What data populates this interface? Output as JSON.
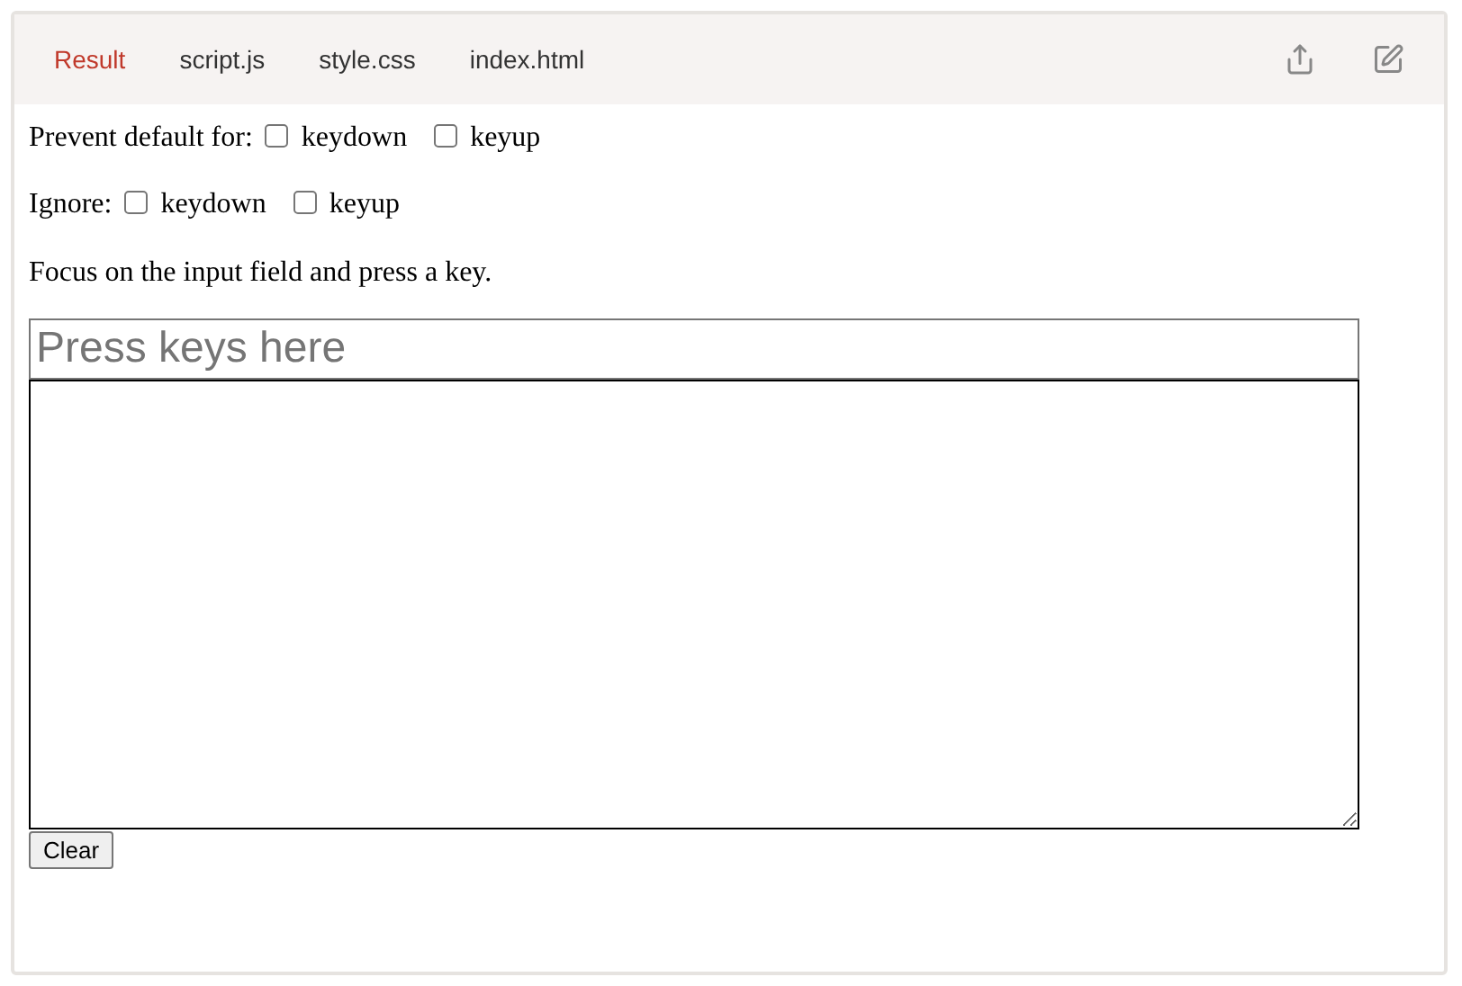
{
  "tabs": [
    {
      "label": "Result",
      "selected": true
    },
    {
      "label": "script.js",
      "selected": false
    },
    {
      "label": "style.css",
      "selected": false
    },
    {
      "label": "index.html",
      "selected": false
    }
  ],
  "option_rows": [
    {
      "label": "Prevent default for:",
      "options": [
        {
          "label": "keydown",
          "checked": false
        },
        {
          "label": "keyup",
          "checked": false
        }
      ]
    },
    {
      "label": "Ignore:",
      "options": [
        {
          "label": "keydown",
          "checked": false
        },
        {
          "label": "keyup",
          "checked": false
        }
      ]
    }
  ],
  "instructions": "Focus on the input field and press a key.",
  "key_input": {
    "placeholder": "Press keys here"
  },
  "clear_button": "Clear"
}
